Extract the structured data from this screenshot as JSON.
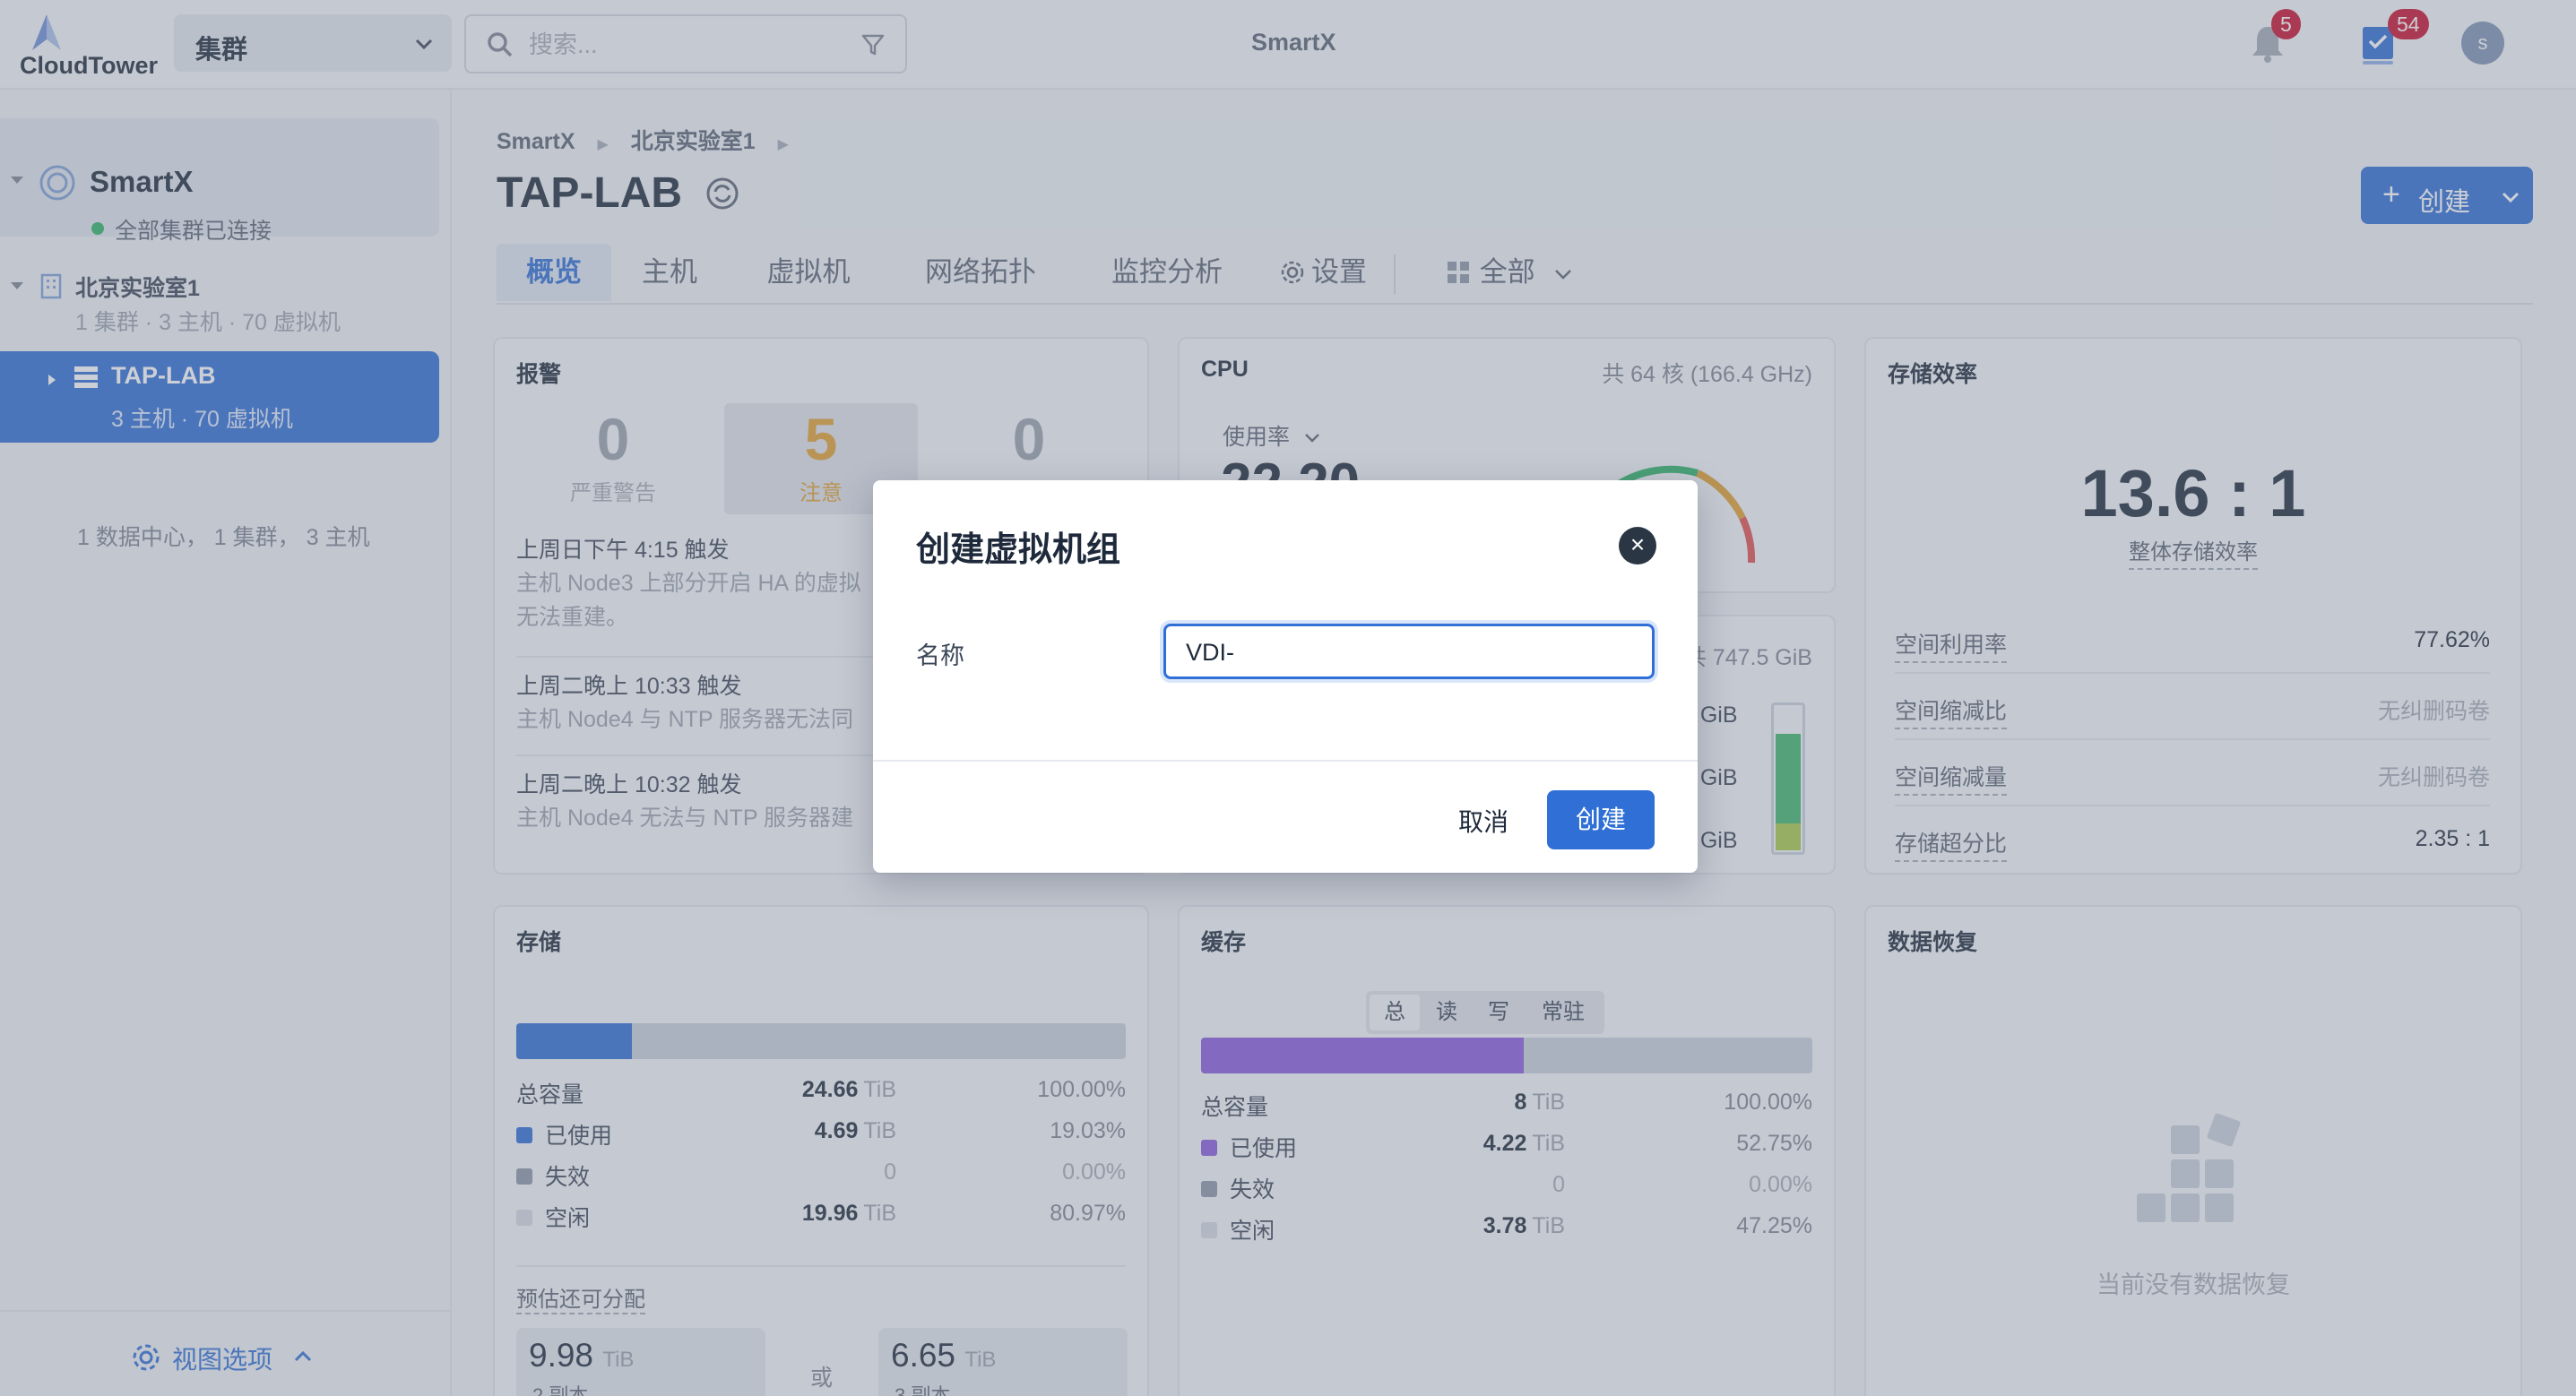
{
  "app": {
    "logo_text": "CloudTower",
    "title": "SmartX"
  },
  "topbar": {
    "cluster_select": "集群",
    "search_placeholder": "搜索...",
    "notifications": "5",
    "tasks": "54",
    "avatar": "s"
  },
  "sidebar": {
    "org_name": "SmartX",
    "org_status": "全部集群已连接",
    "datacenter_name": "北京实验室1",
    "datacenter_meta": "1 集群 · 3 主机 · 70 虚拟机",
    "cluster_name": "TAP-LAB",
    "cluster_meta": "3 主机 · 70 虚拟机",
    "summary": "1 数据中心， 1 集群， 3 主机",
    "view_options": "视图选项"
  },
  "header": {
    "breadcrumb": [
      "SmartX",
      "北京实验室1"
    ],
    "title": "TAP-LAB",
    "create_label": "创建",
    "tabs": [
      "概览",
      "主机",
      "虚拟机",
      "网络拓扑",
      "监控分析",
      "设置",
      "全部"
    ]
  },
  "alarm": {
    "title": "报警",
    "counts": [
      {
        "value": "0",
        "label": "严重警告"
      },
      {
        "value": "5",
        "label": "注意"
      },
      {
        "value": "0",
        "label": ""
      }
    ],
    "items": [
      {
        "time": "上周日下午 4:15 触发",
        "desc_1": "主机 Node3 上部分开启 HA 的虚拟",
        "desc_2": "无法重建。"
      },
      {
        "time": "上周二晚上 10:33 触发",
        "desc_1": "主机 Node4 与 NTP 服务器无法同"
      },
      {
        "time": "上周二晚上 10:32 触发",
        "desc_1": "主机 Node4 无法与 NTP 服务器建"
      }
    ]
  },
  "cpu": {
    "title": "CPU",
    "total": "共 64 核 (166.4 GHz)",
    "metric_select": "使用率",
    "value_partial": "22.20",
    "gauge_color_ok": "#2fb368",
    "gauge_color_warn": "#e0a030",
    "gauge_color_crit": "#e05050"
  },
  "memory_partial": {
    "total": "共 747.5 GiB",
    "rows": [
      "5 GiB",
      "3 GiB",
      "4 GiB"
    ]
  },
  "storage_efficiency": {
    "title": "存储效率",
    "ratio": "13.6 : 1",
    "ratio_label": "整体存储效率",
    "rows": [
      {
        "k": "空间利用率",
        "v": "77.62%"
      },
      {
        "k": "空间缩减比",
        "v": "无纠删码卷"
      },
      {
        "k": "空间缩减量",
        "v": "无纠删码卷"
      },
      {
        "k": "存储超分比",
        "v": "2.35 : 1"
      }
    ]
  },
  "storage": {
    "title": "存储",
    "used_fraction": 0.1903,
    "colors": {
      "used": "#2f6fd6",
      "invalid": "#8c96a6",
      "free": "#c9d0db"
    },
    "rows": [
      {
        "k": "总容量",
        "v": "24.66",
        "u": "TiB",
        "p": "100.00%"
      },
      {
        "k": "已使用",
        "v": "4.69",
        "u": "TiB",
        "p": "19.03%"
      },
      {
        "k": "失效",
        "v": "0",
        "u": "",
        "p": "0.00%"
      },
      {
        "k": "空闲",
        "v": "19.96",
        "u": "TiB",
        "p": "80.97%"
      }
    ],
    "estimate_label": "预估还可分配",
    "est_a": {
      "v": "9.98",
      "u": "TiB",
      "r": "2 副本"
    },
    "or": "或",
    "est_b": {
      "v": "6.65",
      "u": "TiB",
      "r": "3 副本"
    }
  },
  "cache": {
    "title": "缓存",
    "segments": [
      "总",
      "读",
      "写",
      "常驻"
    ],
    "used_fraction": 0.5275,
    "colors": {
      "used": "#8a5bdc"
    },
    "rows": [
      {
        "k": "总容量",
        "v": "8",
        "u": "TiB",
        "p": "100.00%"
      },
      {
        "k": "已使用",
        "v": "4.22",
        "u": "TiB",
        "p": "52.75%"
      },
      {
        "k": "失效",
        "v": "0",
        "u": "",
        "p": "0.00%"
      },
      {
        "k": "空闲",
        "v": "3.78",
        "u": "TiB",
        "p": "47.25%"
      }
    ]
  },
  "recovery": {
    "title": "数据恢复",
    "empty": "当前没有数据恢复"
  },
  "modal": {
    "title": "创建虚拟机组",
    "field_label": "名称",
    "field_value": "VDI-",
    "cancel": "取消",
    "confirm": "创建"
  }
}
